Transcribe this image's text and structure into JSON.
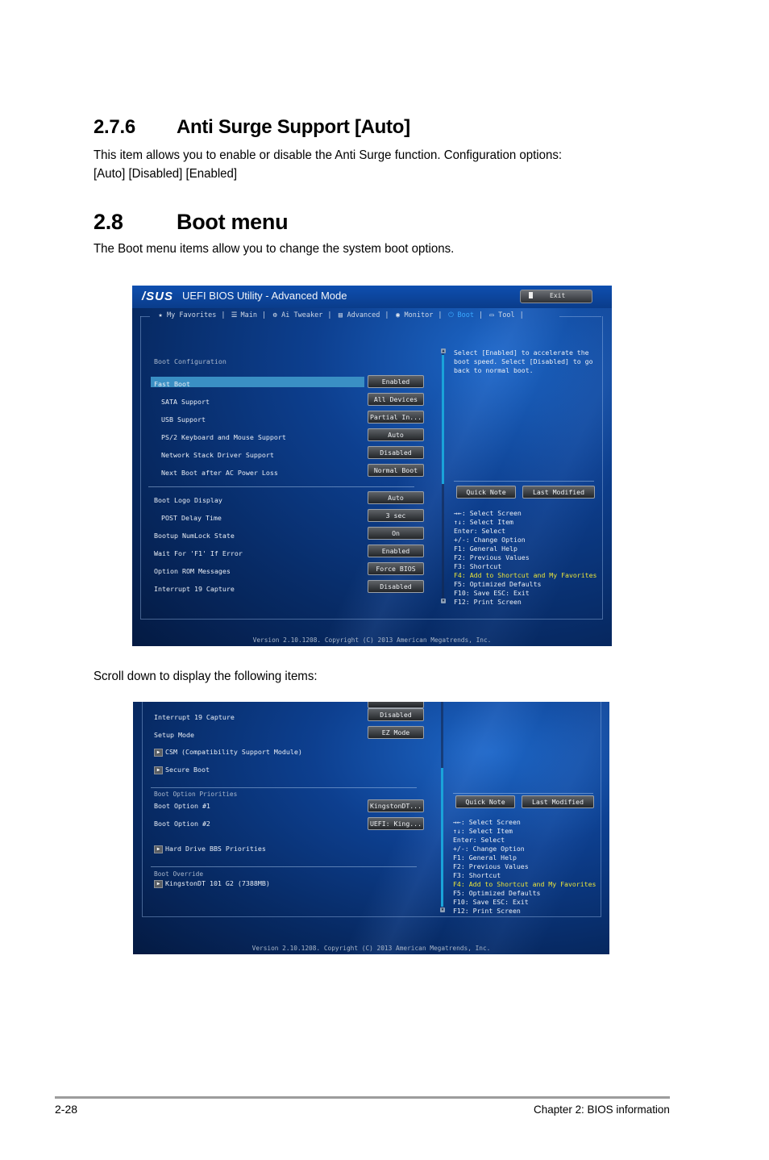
{
  "section_276": {
    "number": "2.7.6",
    "title": "Anti Surge Support [Auto]",
    "body_line1": "This item allows you to enable or disable the Anti Surge function. Configuration options:",
    "body_line2": "[Auto] [Disabled] [Enabled]"
  },
  "section_28": {
    "number": "2.8",
    "title": "Boot menu",
    "body": "The Boot menu items allow you to change the system boot options."
  },
  "scroll_note": "Scroll down to display the following items:",
  "bios": {
    "logo": "/SUS",
    "title": "UEFI BIOS Utility - Advanced Mode",
    "exit_label": "Exit",
    "tabs": [
      {
        "label": "My Favorites",
        "icon": "star-icon",
        "glyph": "★"
      },
      {
        "label": "Main",
        "icon": "list-icon",
        "glyph": "☰"
      },
      {
        "label": "Ai Tweaker",
        "icon": "tweaker-icon",
        "glyph": "⚙"
      },
      {
        "label": "Advanced",
        "icon": "advanced-icon",
        "glyph": "▤"
      },
      {
        "label": "Monitor",
        "icon": "monitor-icon",
        "glyph": "◉"
      },
      {
        "label": "Boot",
        "icon": "power-icon",
        "glyph": "⏻",
        "active": true
      },
      {
        "label": "Tool",
        "icon": "printer-icon",
        "glyph": "▭"
      }
    ],
    "tab_separator": "|",
    "quick_note": "Quick Note",
    "last_modified": "Last Modified",
    "version": "Version 2.10.1208. Copyright (C) 2013 American Megatrends, Inc.",
    "keys": [
      {
        "text": "→←: Select Screen"
      },
      {
        "text": "↑↓: Select Item"
      },
      {
        "text": "Enter: Select"
      },
      {
        "text": "+/-: Change Option"
      },
      {
        "text": "F1: General Help"
      },
      {
        "text": "F2: Previous Values"
      },
      {
        "text": "F3: Shortcut"
      },
      {
        "text": "F4: Add to Shortcut and My Favorites",
        "highlight": true
      },
      {
        "text": "F5: Optimized Defaults"
      },
      {
        "text": "F10: Save  ESC: Exit"
      },
      {
        "text": "F12: Print Screen"
      }
    ],
    "screen1": {
      "group_label": "Boot Configuration",
      "help_text": "Select [Enabled] to accelerate the\nboot speed. Select [Disabled] to go\nback to normal boot.",
      "items": [
        {
          "label": "Fast Boot",
          "value": "Enabled",
          "selected": true
        },
        {
          "label": "SATA Support",
          "value": "All Devices",
          "sub": true
        },
        {
          "label": "USB Support",
          "value": "Partial In...",
          "sub": true
        },
        {
          "label": "PS/2 Keyboard and Mouse Support",
          "value": "Auto",
          "sub": true
        },
        {
          "label": "Network Stack Driver Support",
          "value": "Disabled",
          "sub": true
        },
        {
          "label": "Next Boot after AC Power Loss",
          "value": "Normal Boot",
          "sub": true
        },
        {
          "label": "Boot Logo Display",
          "value": "Auto"
        },
        {
          "label": "POST Delay Time",
          "value": "3 sec",
          "sub": true
        },
        {
          "label": "Bootup NumLock State",
          "value": "On"
        },
        {
          "label": "Wait For 'F1' If Error",
          "value": "Enabled"
        },
        {
          "label": "Option ROM Messages",
          "value": "Force BIOS"
        },
        {
          "label": "Interrupt 19 Capture",
          "value": "Disabled"
        }
      ]
    },
    "screen2": {
      "items": [
        {
          "label": "Interrupt 19 Capture",
          "value": "Disabled"
        },
        {
          "label": "Setup Mode",
          "value": "EZ Mode"
        }
      ],
      "submenus": [
        {
          "label": "CSM (Compatibility Support Module)"
        },
        {
          "label": "Secure Boot"
        }
      ],
      "priorities_label": "Boot Option Priorities",
      "boot_options": [
        {
          "label": "Boot Option #1",
          "value": "KingstonDT..."
        },
        {
          "label": "Boot Option #2",
          "value": "UEFI: King..."
        }
      ],
      "hdd_bbs": "Hard Drive BBS Priorities",
      "override_label": "Boot Override",
      "override_item": "KingstonDT 101 G2  (7388MB)"
    }
  },
  "footer": {
    "page_number": "2-28",
    "chapter": "Chapter 2: BIOS information"
  }
}
